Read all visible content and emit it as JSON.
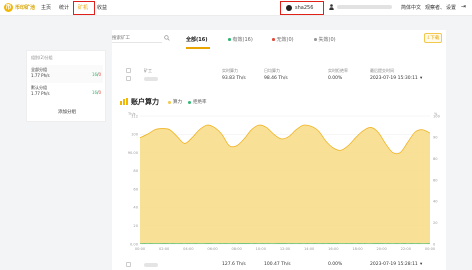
{
  "brand": {
    "name": "币印矿池",
    "mark": "币"
  },
  "nav": [
    {
      "label": "主页",
      "active": false
    },
    {
      "label": "统计",
      "active": false
    },
    {
      "label": "矿机",
      "active": true
    },
    {
      "label": "收益",
      "active": false
    }
  ],
  "coin": {
    "label": "sha256"
  },
  "topbar": {
    "language": "简体中文",
    "guest": "观察者、",
    "settings": "设置"
  },
  "sidebar": {
    "header": "组别(2)分组",
    "groups": [
      {
        "name": "全部分组",
        "rate": "1.77 Ph/s",
        "online": "16",
        "offline": "0"
      },
      {
        "name": "默认分组",
        "rate": "1.77 Ph/s",
        "online": "16",
        "offline": "0"
      }
    ],
    "add_label": "添加分组"
  },
  "search": {
    "placeholder": "搜索矿工"
  },
  "tabs": [
    {
      "label": "全部(16)",
      "active": true,
      "dot": ""
    },
    {
      "label": "有效(16)",
      "active": false,
      "dot": "#2eb872"
    },
    {
      "label": "无效(0)",
      "active": false,
      "dot": "#e04a3b"
    },
    {
      "label": "失效(0)",
      "active": false,
      "dot": "#999999"
    }
  ],
  "download_label": "下载",
  "table": {
    "headers": [
      "矿工",
      "实时算力",
      "日均算力",
      "实时拒绝率",
      "最后提交时间"
    ],
    "rows": [
      {
        "rt": "93.83 Th/s",
        "avg": "98.46 Th/s",
        "reject": "0.00%",
        "time": "2023-07-19 15:30:11"
      },
      {
        "rt": "127.6 Th/s",
        "avg": "100.47 Th/s",
        "reject": "0.00%",
        "time": "2023-07-19 15:28:11"
      }
    ]
  },
  "chart_data": {
    "type": "area",
    "title": "账户算力",
    "legend": [
      {
        "name": "算力",
        "color": "#f2c94c"
      },
      {
        "name": "拒绝率",
        "color": "#2eb872"
      }
    ],
    "ylabel": "Th/s",
    "y2label": "%",
    "ylim": [
      0,
      112
    ],
    "y_ticks": [
      "112",
      "100",
      "90.00",
      "80",
      "60",
      "40",
      "20",
      "0.00"
    ],
    "y2_ticks": [
      "100",
      "90",
      "80",
      "60",
      "40",
      "20",
      "0"
    ],
    "x_ticks": [
      "00:00",
      "02:00",
      "04:00",
      "06:00",
      "08:00",
      "10:00",
      "12:00",
      "14:00",
      "16:00",
      "18:00",
      "20:00",
      "22:00",
      "00:00"
    ],
    "series": [
      {
        "name": "算力",
        "values": [
          93,
          96,
          100,
          101,
          100,
          94,
          88,
          93,
          100,
          104,
          102,
          96,
          86,
          86,
          92,
          100,
          104,
          102,
          96,
          92,
          94,
          100,
          104,
          103,
          99,
          90,
          84,
          82,
          86,
          93,
          99,
          102,
          98,
          88,
          80,
          80,
          89,
          98,
          100,
          97
        ]
      },
      {
        "name": "拒绝率",
        "values": [
          0.4,
          0.4,
          0.3,
          0.5,
          0.4,
          0.3,
          0.4,
          0.4,
          0.3,
          0.5,
          0.4,
          0.4,
          0.3,
          0.4,
          0.5,
          0.4,
          0.3,
          0.4,
          0.4,
          0.5,
          0.4,
          0.3,
          0.4,
          0.4,
          0.3,
          0.4,
          0.5,
          0.4,
          0.4,
          0.3,
          0.4,
          0.4,
          0.5,
          0.4,
          0.3,
          0.4,
          0.4,
          0.4,
          0.3,
          0.4
        ]
      }
    ],
    "grid": true,
    "legend_position": "top-left"
  },
  "colors": {
    "accent": "#e8a500",
    "highlight": "#e0201a",
    "area": "#f7dc85",
    "line": "#f0b323"
  }
}
